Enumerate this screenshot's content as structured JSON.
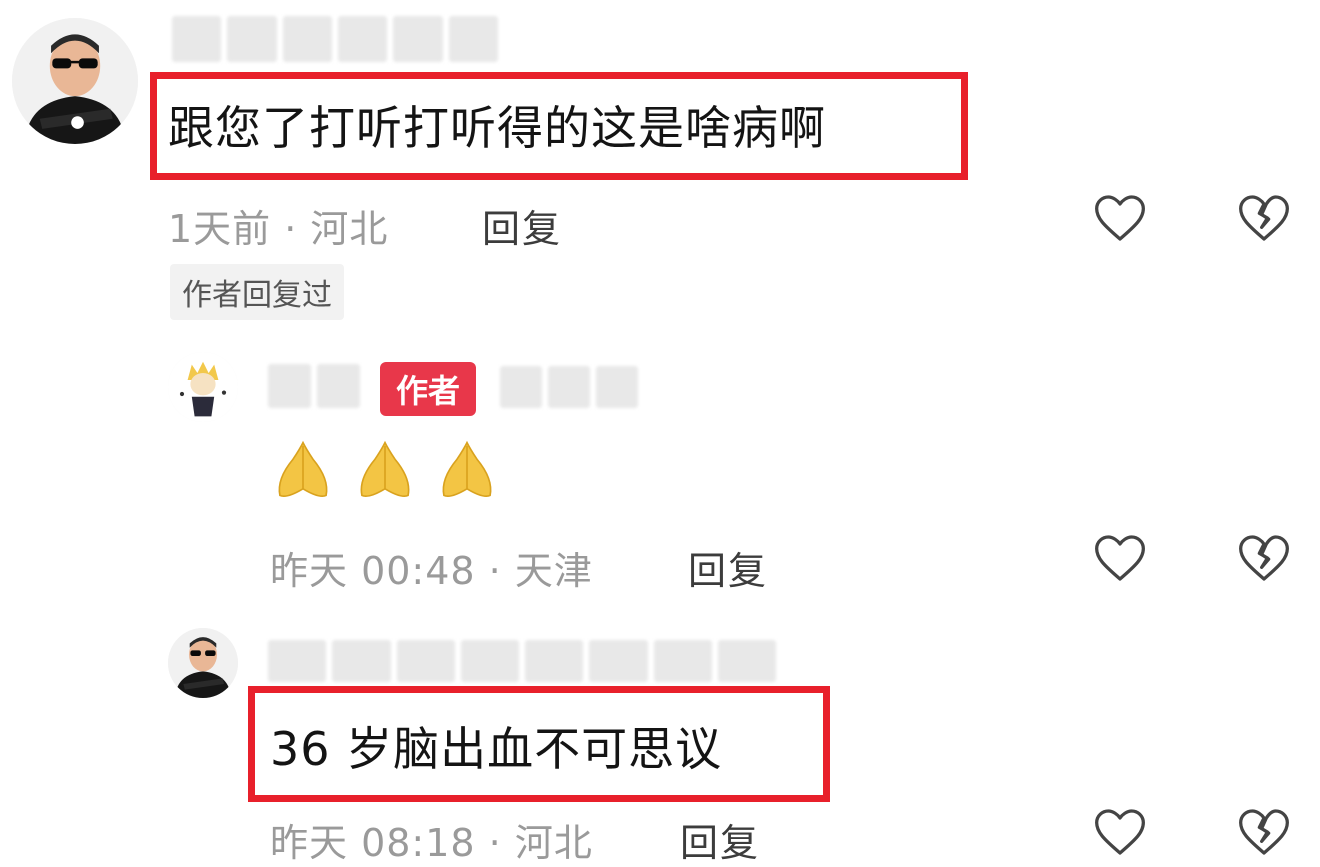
{
  "comments": [
    {
      "text": "跟您了打听打听得的这是啥病啊",
      "meta": "1天前 · 河北",
      "reply_label": "回复",
      "author_replied_tag": "作者回复过"
    },
    {
      "author_badge": "作者",
      "emoji": [
        "pray-emoji",
        "pray-emoji",
        "pray-emoji"
      ],
      "meta": "昨天 00:48 · 天津",
      "reply_label": "回复"
    },
    {
      "text": "36 岁脑出血不可思议",
      "meta": "昨天 08:18 · 河北",
      "reply_label": "回复"
    }
  ],
  "icons": {
    "like": "heart-icon",
    "dislike": "broken-heart-icon"
  },
  "colors": {
    "highlight": "#e8202b",
    "author_badge": "#e8374a",
    "meta_text": "#9a9a9a"
  }
}
